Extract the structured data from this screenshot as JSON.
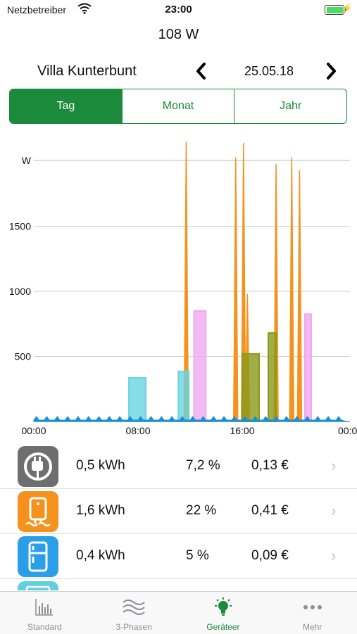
{
  "status": {
    "carrier": "Netzbetreiber",
    "time": "23:00"
  },
  "header": {
    "power": "108 W",
    "site": "Villa Kunterbunt",
    "date": "25.05.18"
  },
  "period_tabs": [
    {
      "label": "Tag",
      "active": true
    },
    {
      "label": "Monat",
      "active": false
    },
    {
      "label": "Jahr",
      "active": false
    }
  ],
  "chart_data": {
    "type": "area",
    "unit_label": "W",
    "y_ticks": [
      500,
      1000,
      1500
    ],
    "x_ticks": [
      "00:00",
      "08:00",
      "16:00",
      "00:0"
    ],
    "x_range_hours": [
      0,
      24
    ],
    "y_range": [
      0,
      2000
    ],
    "series": [
      {
        "color": "#f5921e",
        "spikes": [
          [
            11.7,
            2150
          ],
          [
            15.5,
            2030
          ],
          [
            16.1,
            2140
          ],
          [
            16.4,
            980
          ],
          [
            18.6,
            1980
          ],
          [
            19.8,
            2030
          ],
          [
            20.4,
            1930
          ]
        ]
      },
      {
        "color": "#f0a8f0",
        "blocks": [
          [
            12.3,
            13.2,
            850
          ],
          [
            20.8,
            21.3,
            825
          ]
        ]
      },
      {
        "color": "#6ad3e0",
        "blocks": [
          [
            7.3,
            8.6,
            335
          ],
          [
            11.1,
            11.9,
            385
          ]
        ]
      },
      {
        "color": "#8a9a1a",
        "blocks": [
          [
            16.0,
            17.3,
            520
          ],
          [
            18.0,
            18.6,
            680
          ]
        ]
      },
      {
        "color": "#1a8fd8",
        "baseline": 45
      }
    ]
  },
  "devices": [
    {
      "icon": "plug-icon",
      "color": "#6e6e6e",
      "kwh": "0,5 kWh",
      "percent": "7,2 %",
      "cost": "0,13 €"
    },
    {
      "icon": "boiler-icon",
      "color": "#f5921e",
      "kwh": "1,6 kWh",
      "percent": "22 %",
      "cost": "0,41 €"
    },
    {
      "icon": "fridge-icon",
      "color": "#2a9fe8",
      "kwh": "0,4 kWh",
      "percent": "5 %",
      "cost": "0,09 €"
    },
    {
      "icon": "appliance-icon",
      "color": "#5fd0e0",
      "kwh": "",
      "percent": "",
      "cost": ""
    }
  ],
  "tabbar": [
    {
      "label": "Standard",
      "icon": "bar-chart-icon",
      "active": false
    },
    {
      "label": "3-Phasen",
      "icon": "waves-icon",
      "active": false
    },
    {
      "label": "Geräteer",
      "icon": "lightbulb-icon",
      "active": true
    },
    {
      "label": "Mehr",
      "icon": "more-icon",
      "active": false
    }
  ],
  "colors": {
    "accent": "#1b8a3b"
  }
}
